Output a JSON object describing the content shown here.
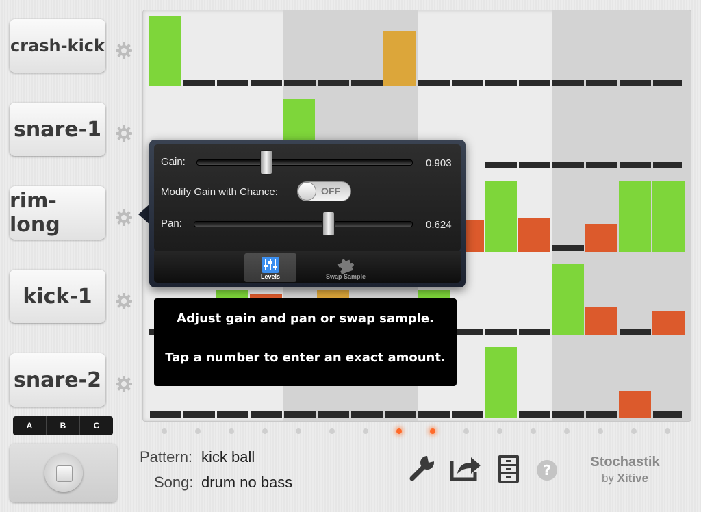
{
  "tracks": [
    {
      "name": "crash-kick"
    },
    {
      "name": "snare-1"
    },
    {
      "name": "rim-long"
    },
    {
      "name": "kick-1"
    },
    {
      "name": "snare-2"
    }
  ],
  "pattern_banks": [
    "A",
    "B",
    "C"
  ],
  "active_playhead_steps": [
    7,
    8
  ],
  "popover": {
    "gain_label": "Gain:",
    "gain_value": "0.903",
    "modify_label": "Modify Gain with Chance:",
    "toggle_state": "OFF",
    "pan_label": "Pan:",
    "pan_value": "0.624",
    "tabs": [
      {
        "label": "Levels",
        "icon": "sliders-icon",
        "selected": true
      },
      {
        "label": "Swap Sample",
        "icon": "puzzle-icon",
        "selected": false
      }
    ]
  },
  "hint": {
    "line1": "Adjust gain and pan  or swap sample.",
    "line2": "Tap a number to enter an exact amount."
  },
  "footer": {
    "pattern_label": "Pattern:",
    "pattern_value": "kick ball",
    "song_label": "Song:",
    "song_value": "drum no bass",
    "brand_name": "Stochastik",
    "brand_by": "by",
    "brand_company": "Xitive"
  },
  "icons": [
    "gear-icon",
    "stop-icon",
    "wrench-icon",
    "share-icon",
    "file-cabinet-icon",
    "help-icon"
  ],
  "colors": {
    "green": "#7ed63a",
    "orange": "#dc5a2c",
    "amber": "#dca63a",
    "dash": "#2a2a2a"
  }
}
